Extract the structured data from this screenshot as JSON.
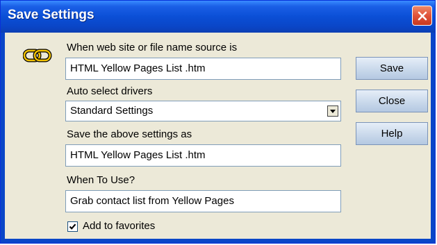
{
  "window": {
    "title": "Save Settings"
  },
  "form": {
    "source_label": "When web site or file name source is",
    "source_value": "HTML Yellow Pages List .htm",
    "drivers_label": "Auto select drivers",
    "drivers_selected": "Standard Settings",
    "save_as_label": "Save the above settings as",
    "save_as_value": "HTML Yellow Pages List .htm",
    "when_label": "When To Use?",
    "when_value": "Grab contact list from Yellow Pages",
    "favorites_label": "Add to favorites",
    "favorites_checked": true
  },
  "buttons": {
    "save": "Save",
    "close": "Close",
    "help": "Help"
  },
  "icons": {
    "link": "chain-link-icon",
    "close": "close-x-icon",
    "dropdown": "dropdown-arrow-icon",
    "check": "checkmark-icon"
  },
  "colors": {
    "titlebar": "#0b4fd6",
    "close_button": "#e0533a",
    "dialog_bg": "#ece9d8",
    "chain_icon": "#f2c200"
  }
}
